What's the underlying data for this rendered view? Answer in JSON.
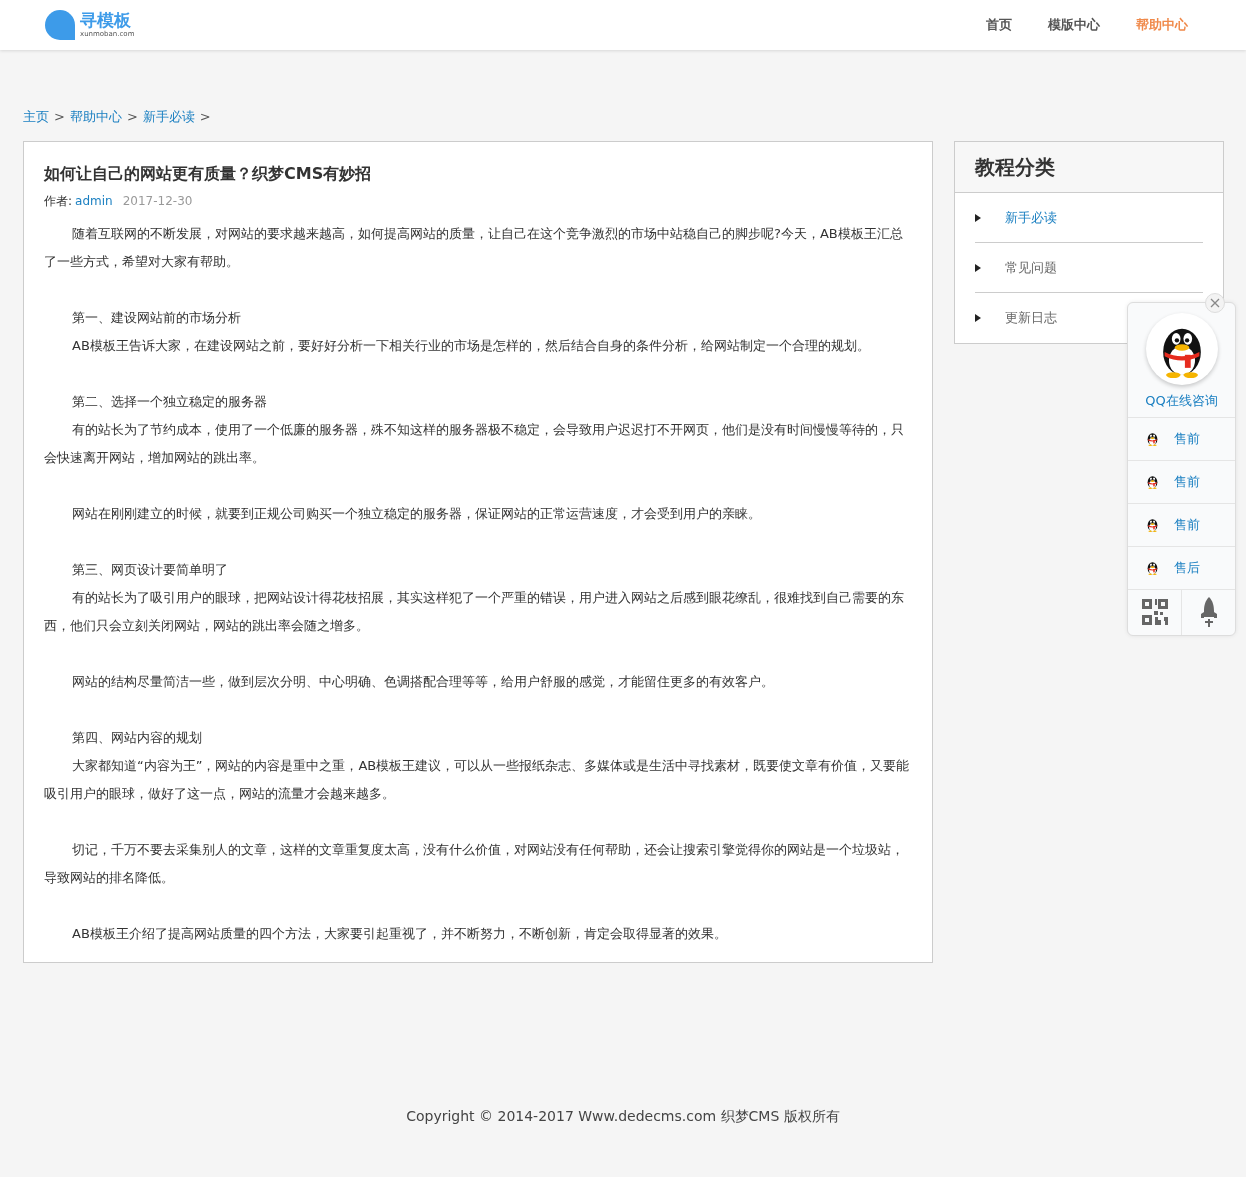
{
  "header": {
    "logo": {
      "name": "寻模板",
      "domain": "xunmoban.com"
    },
    "nav": [
      {
        "label": "首页",
        "selected": false
      },
      {
        "label": "模版中心",
        "selected": false
      },
      {
        "label": "帮助中心",
        "selected": true
      }
    ]
  },
  "breadcrumb": [
    {
      "label": "主页",
      "separator": ">"
    },
    {
      "label": "帮助中心",
      "separator": ">"
    },
    {
      "label": "新手必读",
      "separator": ">"
    }
  ],
  "article": {
    "title": "如何让自己的网站更有质量？织梦CMS有妙招",
    "author_label": "作者:",
    "author": "admin",
    "date": "2017-12-30",
    "sections": [
      [
        "随着互联网的不断发展，对网站的要求越来越高，如何提高网站的质量，让自己在这个竞争激烈的市场中站稳自己的脚步呢?今天，AB模板王汇总了一些方式，希望对大家有帮助。"
      ],
      [
        "第一、建设网站前的市场分析",
        "AB模板王告诉大家，在建设网站之前，要好好分析一下相关行业的市场是怎样的，然后结合自身的条件分析，给网站制定一个合理的规划。"
      ],
      [
        "第二、选择一个独立稳定的服务器",
        "有的站长为了节约成本，使用了一个低廉的服务器，殊不知这样的服务器极不稳定，会导致用户迟迟打不开网页，他们是没有时间慢慢等待的，只会快速离开网站，增加网站的跳出率。"
      ],
      [
        "网站在刚刚建立的时候，就要到正规公司购买一个独立稳定的服务器，保证网站的正常运营速度，才会受到用户的亲睐。"
      ],
      [
        "第三、网页设计要简单明了",
        "有的站长为了吸引用户的眼球，把网站设计得花枝招展，其实这样犯了一个严重的错误，用户进入网站之后感到眼花缭乱，很难找到自己需要的东西，他们只会立刻关闭网站，网站的跳出率会随之增多。"
      ],
      [
        "网站的结构尽量简洁一些，做到层次分明、中心明确、色调搭配合理等等，给用户舒服的感觉，才能留住更多的有效客户。"
      ],
      [
        "第四、网站内容的规划",
        "大家都知道“内容为王”，网站的内容是重中之重，AB模板王建议，可以从一些报纸杂志、多媒体或是生活中寻找素材，既要使文章有价值，又要能吸引用户的眼球，做好了这一点，网站的流量才会越来越多。"
      ],
      [
        "切记，千万不要去采集别人的文章，这样的文章重复度太高，没有什么价值，对网站没有任何帮助，还会让搜索引擎觉得你的网站是一个垃圾站，导致网站的排名降低。"
      ],
      [
        "AB模板王介绍了提高网站质量的四个方法，大家要引起重视了，并不断努力，不断创新，肯定会取得显著的效果。"
      ]
    ]
  },
  "sidebar": {
    "title": "教程分类",
    "items": [
      {
        "label": "新手必读",
        "selected": true
      },
      {
        "label": "常见问题",
        "selected": false
      },
      {
        "label": "更新日志",
        "selected": false
      }
    ]
  },
  "qq_widget": {
    "title": "QQ在线咨询",
    "items": [
      "售前",
      "售前",
      "售前",
      "售后"
    ]
  },
  "footer": "Copyright © 2014-2017 Www.dedecms.com 织梦CMS 版权所有"
}
